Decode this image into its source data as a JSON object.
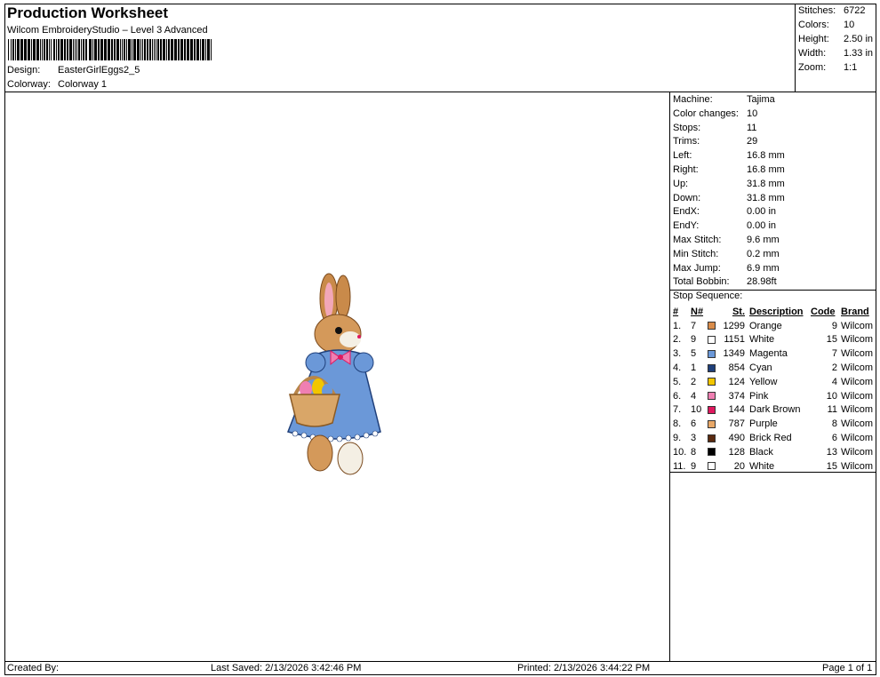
{
  "header": {
    "title": "Production Worksheet",
    "software": "Wilcom EmbroideryStudio – Level 3 Advanced",
    "design_label": "Design:",
    "design_value": "EasterGirlEggs2_5",
    "colorway_label": "Colorway:",
    "colorway_value": "Colorway 1"
  },
  "summary": [
    {
      "label": "Stitches:",
      "value": "6722"
    },
    {
      "label": "Colors:",
      "value": "10"
    },
    {
      "label": "Height:",
      "value": "2.50 in"
    },
    {
      "label": "Width:",
      "value": "1.33 in"
    },
    {
      "label": "Zoom:",
      "value": "1:1"
    }
  ],
  "machine_info": [
    {
      "label": "Machine:",
      "value": "Tajima"
    },
    {
      "label": "Color changes:",
      "value": "10"
    },
    {
      "label": "Stops:",
      "value": "11"
    },
    {
      "label": "Trims:",
      "value": "29"
    },
    {
      "label": "Left:",
      "value": "16.8 mm"
    },
    {
      "label": "Right:",
      "value": "16.8 mm"
    },
    {
      "label": "Up:",
      "value": "31.8 mm"
    },
    {
      "label": "Down:",
      "value": "31.8 mm"
    },
    {
      "label": "EndX:",
      "value": "0.00 in"
    },
    {
      "label": "EndY:",
      "value": "0.00 in"
    },
    {
      "label": "Max Stitch:",
      "value": "9.6 mm"
    },
    {
      "label": "Min Stitch:",
      "value": "0.2 mm"
    },
    {
      "label": "Max Jump:",
      "value": "6.9 mm"
    },
    {
      "label": "Total Bobbin:",
      "value": "28.98ft"
    }
  ],
  "stop_sequence": {
    "heading": "Stop Sequence:",
    "columns": [
      "#",
      "N#",
      "St.",
      "Description",
      "Code",
      "Brand"
    ],
    "rows": [
      {
        "idx": "1.",
        "n": "7",
        "color": "#d98c4a",
        "st": "1299",
        "desc": "Orange",
        "code": "9",
        "brand": "Wilcom"
      },
      {
        "idx": "2.",
        "n": "9",
        "color": "#ffffff",
        "st": "1151",
        "desc": "White",
        "code": "15",
        "brand": "Wilcom"
      },
      {
        "idx": "3.",
        "n": "5",
        "color": "#6b98d8",
        "st": "1349",
        "desc": "Magenta",
        "code": "7",
        "brand": "Wilcom"
      },
      {
        "idx": "4.",
        "n": "1",
        "color": "#1f3f7a",
        "st": "854",
        "desc": "Cyan",
        "code": "2",
        "brand": "Wilcom"
      },
      {
        "idx": "5.",
        "n": "2",
        "color": "#f2c600",
        "st": "124",
        "desc": "Yellow",
        "code": "4",
        "brand": "Wilcom"
      },
      {
        "idx": "6.",
        "n": "4",
        "color": "#ef7fb2",
        "st": "374",
        "desc": "Pink",
        "code": "10",
        "brand": "Wilcom"
      },
      {
        "idx": "7.",
        "n": "10",
        "color": "#e0185f",
        "st": "144",
        "desc": "Dark Brown",
        "code": "11",
        "brand": "Wilcom"
      },
      {
        "idx": "8.",
        "n": "6",
        "color": "#e8a868",
        "st": "787",
        "desc": "Purple",
        "code": "8",
        "brand": "Wilcom"
      },
      {
        "idx": "9.",
        "n": "3",
        "color": "#5a2a10",
        "st": "490",
        "desc": "Brick Red",
        "code": "6",
        "brand": "Wilcom"
      },
      {
        "idx": "10.",
        "n": "8",
        "color": "#000000",
        "st": "128",
        "desc": "Black",
        "code": "13",
        "brand": "Wilcom"
      },
      {
        "idx": "11.",
        "n": "9",
        "color": "#ffffff",
        "st": "20",
        "desc": "White",
        "code": "15",
        "brand": "Wilcom"
      }
    ]
  },
  "footer": {
    "created_by": "Created By:",
    "last_saved": "Last Saved: 2/13/2026 3:42:46 PM",
    "printed": "Printed: 2/13/2026 3:44:22 PM",
    "page": "Page 1 of 1"
  }
}
